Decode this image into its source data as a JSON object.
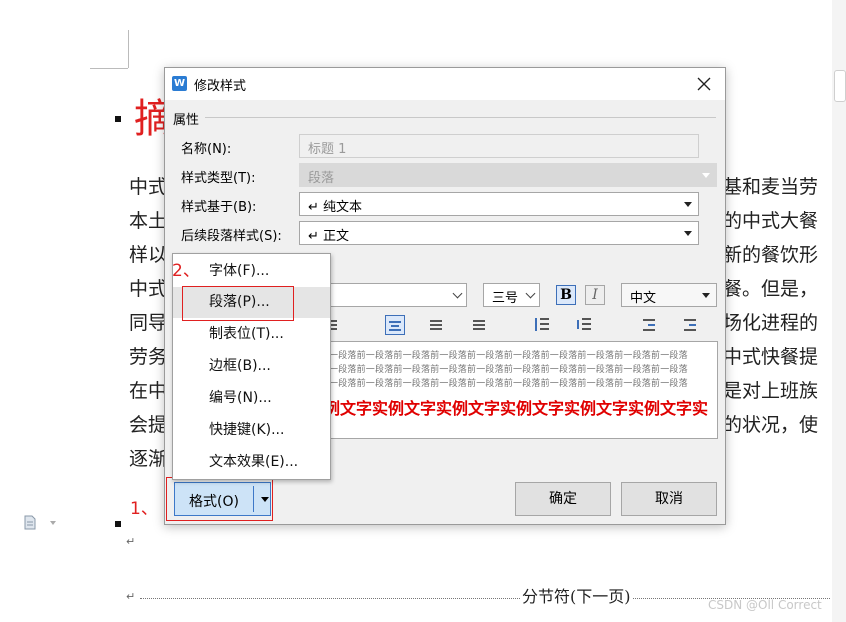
{
  "document": {
    "heading_char": "摘",
    "left_lines": [
      "中式",
      "本土",
      "样以",
      "中式",
      "同导",
      "劳务",
      "在中",
      "会提",
      "逐渐"
    ],
    "right_lines": [
      "基和麦当劳",
      "的中式大餐",
      "新的餐饮形",
      "餐。但是，",
      "场化进程的",
      "中式快餐提",
      "是对上班族",
      "的状况，使"
    ],
    "para_mark": "↵",
    "section_break": "分节符(下一页)",
    "watermark": "CSDN @Oll Correct"
  },
  "dialog": {
    "title": "修改样式",
    "icon_letter": "W",
    "properties_label": "属性",
    "name_label": "名称(N):",
    "name_value": "标题 1",
    "style_type_label": "样式类型(T):",
    "style_type_value": "段落",
    "based_on_label": "样式基于(B):",
    "based_on_value": "↵ 纯文本",
    "next_style_label": "后续段落样式(S):",
    "next_style_value": "↵ 正文",
    "font_size_value": "三号",
    "bold_label": "B",
    "italic_label": "I",
    "language_value": "中文",
    "preview_prev_lines": [
      "一段落前一段落前一段落前一段落前一段落前一段落前一段落前一段落前一段落前一段落",
      "一段落前一段落前一段落前一段落前一段落前一段落前一段落前一段落前一段落前一段落",
      "一段落前一段落前一段落前一段落前一段落前一段落前一段落前一段落前一段落前一段落"
    ],
    "preview_sample": "例文字实例文字实例文字实例文字实例文字实例文字实",
    "format_button": "格式(O)",
    "ok_button": "确定",
    "cancel_button": "取消"
  },
  "format_menu": {
    "items": [
      "字体(F)...",
      "段落(P)...",
      "制表位(T)...",
      "边框(B)...",
      "编号(N)...",
      "快捷键(K)...",
      "文本效果(E)..."
    ]
  },
  "annotations": {
    "step1": "1、",
    "step2": "2、"
  },
  "colors": {
    "accent_blue": "#3d78c8",
    "annotation_red": "#e02020",
    "preview_red": "#e00000"
  }
}
